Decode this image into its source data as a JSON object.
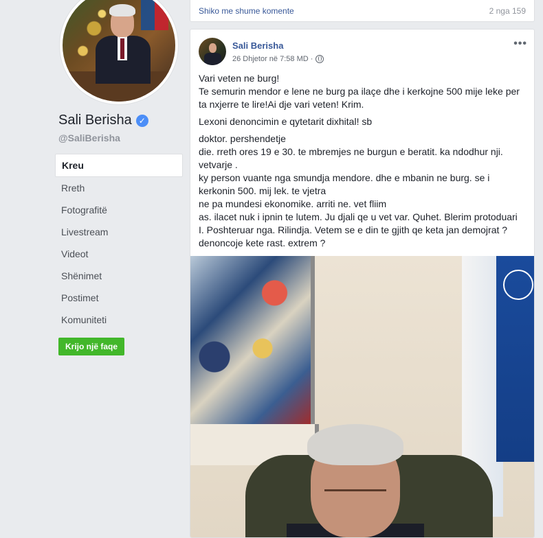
{
  "profile": {
    "name": "Sali Berisha",
    "handle": "@SaliBerisha",
    "verified_icon": "check-icon",
    "create_page_label": "Krijo një faqe"
  },
  "nav": {
    "items": [
      {
        "label": "Kreu",
        "active": true
      },
      {
        "label": "Rreth",
        "active": false
      },
      {
        "label": "Fotografitë",
        "active": false
      },
      {
        "label": "Livestream",
        "active": false
      },
      {
        "label": "Videot",
        "active": false
      },
      {
        "label": "Shënimet",
        "active": false
      },
      {
        "label": "Postimet",
        "active": false
      },
      {
        "label": "Komuniteti",
        "active": false
      }
    ]
  },
  "prev_post": {
    "more_comments_label": "Shiko me shume komente",
    "count_label": "2 nga 159"
  },
  "post": {
    "author": "Sali Berisha",
    "timestamp": "26 Dhjetor në 7:58 MD ·",
    "privacy_icon": "globe-icon",
    "menu_icon": "more-icon",
    "paragraph1": [
      "Vari veten ne burg!",
      "Te semurin mendor e lene ne burg pa ilaçe dhe i kerkojne 500 mije leke per",
      "ta nxjerre te lire!Ai dje vari veten! Krim."
    ],
    "paragraph2": "Lexoni denoncimin e qytetarit dixhital! sb",
    "paragraph3": [
      "doktor. pershendetje",
      "die. rreth ores 19 e 30. te mbremjes ne burgun e beratit. ka ndodhur nji.",
      "vetvarje .",
      "ky person vuante nga smundja mendore. dhe e mbanin ne burg. se i",
      "kerkonin 500. mij lek. te vjetra",
      "ne pa mundesi ekonomike. arriti ne. vet fliim",
      "as. ilacet nuk i ipnin te lutem. Ju djali qe u vet var. Quhet. Blerim protoduari",
      "I. Poshteruar nga. Rilindja. Vetem se e din te gjith qe keta jan demojrat ?",
      "denoncoje kete rast. extrem ?"
    ]
  },
  "colors": {
    "background": "#e9ebee",
    "link": "#385898",
    "create_button": "#42b72a",
    "verified": "#4c8ef7"
  }
}
